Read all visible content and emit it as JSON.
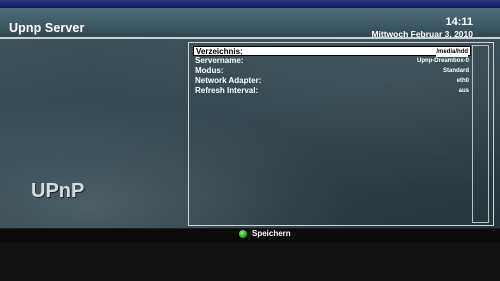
{
  "header": {
    "title": "Upnp Server",
    "time": "14:11",
    "date": "Mittwoch Februar 3, 2010"
  },
  "logo": {
    "text": "UPnP"
  },
  "settings": {
    "rows": [
      {
        "label": "Verzeichnis:",
        "value": "/media/hdd"
      },
      {
        "label": "Servername:",
        "value": "Upnp-Dreambox-0"
      },
      {
        "label": "Modus:",
        "value": "Standard"
      },
      {
        "label": "Network Adapter:",
        "value": "eth0"
      },
      {
        "label": "Refresh Interval:",
        "value": "aus"
      }
    ]
  },
  "footer": {
    "save_label": "Speichern",
    "green_key_color": "#2ebd24"
  }
}
